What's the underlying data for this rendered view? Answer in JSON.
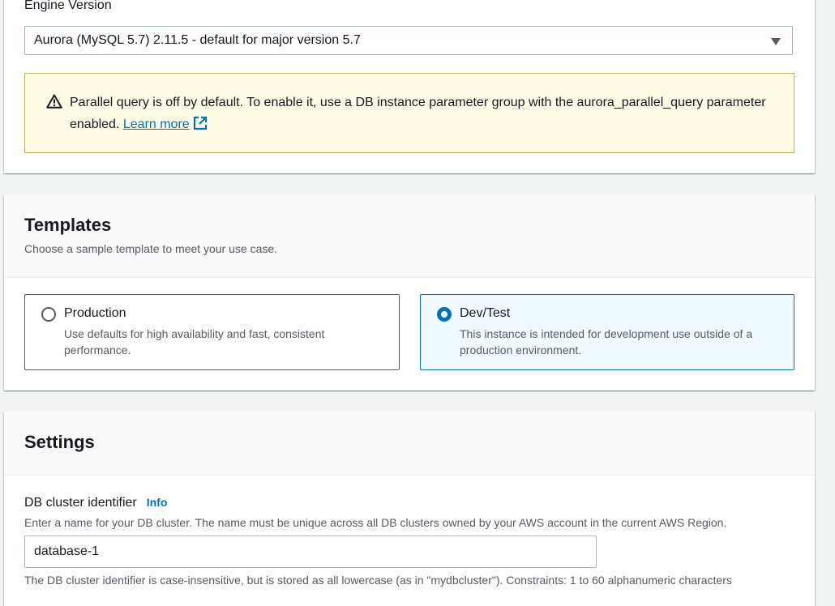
{
  "engine": {
    "label": "Engine Version",
    "selected_value": "Aurora (MySQL 5.7) 2.11.5 - default for major version 5.7",
    "alert_text": "Parallel query is off by default. To enable it, use a DB instance parameter group with the aurora_parallel_query parameter enabled.",
    "alert_link": "Learn more"
  },
  "templates": {
    "title": "Templates",
    "description": "Choose a sample template to meet your use case.",
    "options": [
      {
        "title": "Production",
        "description": "Use defaults for high availability and fast, consistent performance.",
        "selected": false
      },
      {
        "title": "Dev/Test",
        "description": "This instance is intended for development use outside of a production environment.",
        "selected": true
      }
    ]
  },
  "settings": {
    "title": "Settings",
    "cluster_id_label": "DB cluster identifier",
    "info_link": "Info",
    "cluster_id_description": "Enter a name for your DB cluster. The name must be unique across all DB clusters owned by your AWS account in the current AWS Region.",
    "cluster_id_value": "database-1",
    "constraint_text": "The DB cluster identifier is case-insensitive, but is stored as all lowercase (as in \"mydbcluster\"). Constraints: 1 to 60 alphanumeric characters"
  },
  "colors": {
    "accent": "#0073bb",
    "warning_bg": "#fffce5",
    "selected_tile_bg": "#f1faff"
  }
}
